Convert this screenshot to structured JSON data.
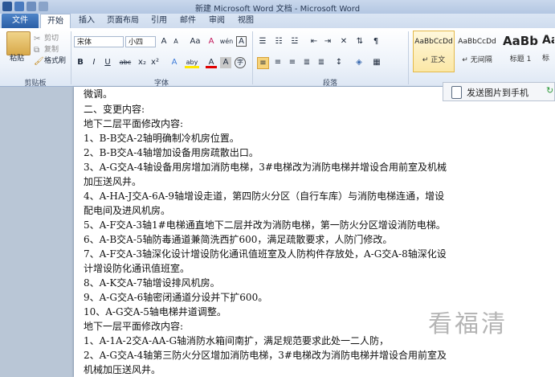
{
  "window": {
    "title": "新建 Microsoft Word 文档 - Microsoft Word"
  },
  "tabs": [
    "文件",
    "开始",
    "插入",
    "页面布局",
    "引用",
    "邮件",
    "审阅",
    "视图"
  ],
  "clipboard": {
    "paste": "粘贴",
    "cut": "剪切",
    "copy": "复制",
    "format_painter": "格式刷",
    "group": "剪贴板"
  },
  "font": {
    "name": "宋体",
    "size": "小四",
    "group": "字体",
    "grow": "A",
    "shrink": "A",
    "case": "Aa",
    "clear": "A",
    "phonetic": "wén",
    "border": "A",
    "bold": "B",
    "italic": "I",
    "underline": "U",
    "strike": "abc",
    "sub": "x₂",
    "sup": "x²",
    "effects": "A",
    "highlight": "aby",
    "color": "A",
    "shade": "A",
    "enclose": "字"
  },
  "paragraph": {
    "group": "段落"
  },
  "styles": [
    {
      "sample": "AaBbCcDd",
      "name": "↵ 正文"
    },
    {
      "sample": "AaBbCcDd",
      "name": "↵ 无间隔"
    },
    {
      "sample": "AaBb",
      "name": "标题 1"
    },
    {
      "sample": "Aa",
      "name": "标"
    }
  ],
  "side_panel": {
    "label": "发送图片到手机"
  },
  "document_lines": [
    "微调。",
    "二、变更内容:",
    "地下二层平面修改内容:",
    "1、B-B交A-2轴明确制冷机房位置。",
    "2、B-B交A-4轴增加设备用房疏散出口。",
    "3、A-G交A-4轴设备用房增加消防电梯，3#电梯改为消防电梯并增设合用前室及机械",
    "加压送风井。",
    "4、A-HA-J交A-6A-9轴增设走道，第四防火分区（自行车库）与消防电梯连通，增设",
    "配电间及进风机房。",
    "5、A-F交A-3轴1#电梯通直地下二层并改为消防电梯，第一防火分区增设消防电梯。",
    "6、A-B交A-5轴防毒通道兼简洗西扩600，满足疏散要求，人防门修改。",
    "7、A-F交A-3轴深化设计增设防化通讯值班室及人防构件存放处，A-G交A-8轴深化设",
    "计增设防化通讯值班室。",
    "8、A-K交A-7轴增设排风机房。",
    "9、A-G交A-6轴密闭通道分设并下扩600。",
    "10、A-G交A-5轴电梯井道调整。",
    "地下一层平面修改内容:",
    "1、A-1A-2交A-AA-G轴消防水箱间南扩，满足规范要求此处一二人防，",
    "2、A-G交A-4轴第三防火分区增加消防电梯，3#电梯改为消防电梯并增设合用前室及",
    "机械加压送风井。"
  ],
  "watermark": "看福清",
  "colors": {
    "file_tab": "#2a5fa6",
    "ribbon": "#eef3fa",
    "page": "#ffffff"
  }
}
